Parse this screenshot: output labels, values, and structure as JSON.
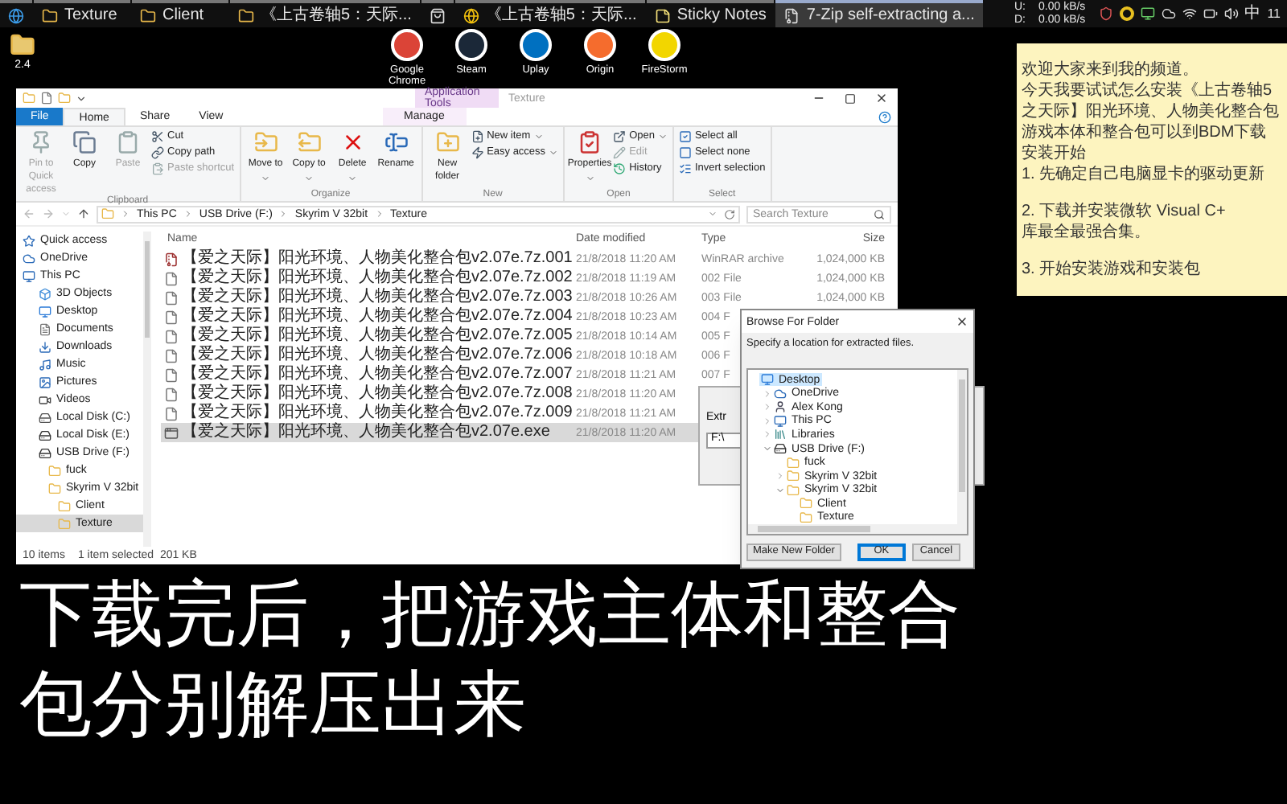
{
  "taskbar": {
    "buttons": [
      {
        "selected": false
      },
      {
        "label": "Texture",
        "selected": false
      },
      {
        "label": "Client",
        "selected": false
      },
      {
        "label": "《上古卷轴5：天际...",
        "selected": false
      },
      {
        "selected": false
      },
      {
        "label": "《上古卷轴5：天际...",
        "selected": false
      },
      {
        "label": "Sticky Notes",
        "selected": false
      },
      {
        "label": "7-Zip self-extracting a...",
        "selected": true
      }
    ],
    "net_speed": [
      {
        "label": "U:",
        "value": "0.00 kB/s"
      },
      {
        "label": "D:",
        "value": "0.00 kB/s"
      }
    ],
    "ime": "中",
    "clock": "11"
  },
  "desktop_icons": [
    {
      "label": "2.4"
    }
  ],
  "shortcuts": [
    {
      "label": "Google Chrome",
      "color": "#db4437"
    },
    {
      "label": "Steam",
      "color": "#1b2838"
    },
    {
      "label": "Uplay",
      "color": "#0070c0"
    },
    {
      "label": "Origin",
      "color": "#f56c2d"
    },
    {
      "label": "FireStorm",
      "color": "#f2d600"
    }
  ],
  "sticky_note": {
    "paragraphs": [
      [
        "欢迎大家来到我的频道。",
        "今天我要试试怎么安装《上古卷轴5",
        "之天际】阳光环境、人物美化整合包",
        "游戏本体和整合包可以到BDM下载",
        "安装开始",
        "1. 先确定自己电脑显卡的驱动更新"
      ],
      [
        "2. 下载并安装微软 Visual C+",
        "库最全最强合集。"
      ],
      [
        "3. 开始安装游戏和安装包"
      ]
    ]
  },
  "explorer": {
    "title": "Texture",
    "context_tab": "Application Tools",
    "tabs": [
      {
        "label": "File",
        "kind": "file",
        "selected": false
      },
      {
        "label": "Home",
        "kind": "tab",
        "selected": true
      },
      {
        "label": "Share",
        "kind": "tab",
        "selected": false
      },
      {
        "label": "View",
        "kind": "tab",
        "selected": false
      },
      {
        "label": "Manage",
        "kind": "context",
        "selected": false
      }
    ],
    "ribbon_groups": [
      {
        "name": "Clipboard",
        "items": [
          {
            "label": "Pin to Quick access",
            "kind": "large",
            "disabled": true,
            "dropdown": false
          },
          {
            "label": "Copy",
            "kind": "large",
            "disabled": false,
            "dropdown": false
          },
          {
            "label": "Paste",
            "kind": "large",
            "disabled": true,
            "dropdown": false
          },
          {
            "label": "Cut",
            "kind": "small",
            "disabled": false,
            "dropdown": false
          },
          {
            "label": "Copy path",
            "kind": "small",
            "disabled": false,
            "dropdown": false
          },
          {
            "label": "Paste shortcut",
            "kind": "small",
            "disabled": true,
            "dropdown": false
          }
        ]
      },
      {
        "name": "Organize",
        "items": [
          {
            "label": "Move to",
            "kind": "large",
            "disabled": false,
            "dropdown": true
          },
          {
            "label": "Copy to",
            "kind": "large",
            "disabled": false,
            "dropdown": true
          },
          {
            "label": "Delete",
            "kind": "large",
            "disabled": false,
            "dropdown": true
          },
          {
            "label": "Rename",
            "kind": "large",
            "disabled": false,
            "dropdown": false
          }
        ]
      },
      {
        "name": "New",
        "items": [
          {
            "label": "New folder",
            "kind": "large",
            "disabled": false,
            "dropdown": false
          },
          {
            "label": "New item",
            "kind": "small",
            "disabled": false,
            "dropdown": true
          },
          {
            "label": "Easy access",
            "kind": "small",
            "disabled": false,
            "dropdown": true
          }
        ]
      },
      {
        "name": "Open",
        "items": [
          {
            "label": "Properties",
            "kind": "large",
            "disabled": false,
            "dropdown": true
          },
          {
            "label": "Open",
            "kind": "small",
            "disabled": false,
            "dropdown": true
          },
          {
            "label": "Edit",
            "kind": "small",
            "disabled": true,
            "dropdown": false
          },
          {
            "label": "History",
            "kind": "small",
            "disabled": false,
            "dropdown": false
          }
        ]
      },
      {
        "name": "Select",
        "items": [
          {
            "label": "Select all",
            "kind": "small",
            "disabled": false,
            "dropdown": false
          },
          {
            "label": "Select none",
            "kind": "small",
            "disabled": false,
            "dropdown": false
          },
          {
            "label": "Invert selection",
            "kind": "small",
            "disabled": false,
            "dropdown": false
          }
        ]
      }
    ],
    "breadcrumb": [
      "This PC",
      "USB Drive (F:)",
      "Skyrim V 32bit",
      "Texture"
    ],
    "search": {
      "placeholder": "Search Texture"
    },
    "nav": [
      {
        "label": "Quick access",
        "kind": "star",
        "selected": false
      },
      {
        "label": "OneDrive",
        "kind": "cloud",
        "selected": false
      },
      {
        "label": "This PC",
        "kind": "pc",
        "selected": false,
        "children": [
          {
            "label": "3D Objects",
            "kind": "cube",
            "selected": false
          },
          {
            "label": "Desktop",
            "kind": "desktop",
            "selected": false
          },
          {
            "label": "Documents",
            "kind": "docs",
            "selected": false
          },
          {
            "label": "Downloads",
            "kind": "download",
            "selected": false
          },
          {
            "label": "Music",
            "kind": "music",
            "selected": false
          },
          {
            "label": "Pictures",
            "kind": "pictures",
            "selected": false
          },
          {
            "label": "Videos",
            "kind": "videos",
            "selected": false
          },
          {
            "label": "Local Disk (C:)",
            "kind": "disk",
            "selected": false
          },
          {
            "label": "Local Disk (E:)",
            "kind": "drive",
            "selected": false
          },
          {
            "label": "USB Drive (F:)",
            "kind": "drive",
            "selected": false,
            "children": [
              {
                "label": "fuck",
                "kind": "folder",
                "selected": false
              },
              {
                "label": "Skyrim V 32bit",
                "kind": "folder",
                "selected": false,
                "children": [
                  {
                    "label": "Client",
                    "kind": "folder",
                    "selected": false
                  },
                  {
                    "label": "Texture",
                    "kind": "folder",
                    "selected": true
                  }
                ]
              }
            ]
          }
        ]
      }
    ],
    "columns": [
      "Name",
      "Date modified",
      "Type",
      "Size"
    ],
    "rows": [
      {
        "name": "【爱之天际】阳光环境、人物美化整合包v2.07e.7z.001",
        "date": "21/8/2018 11:20 AM",
        "type": "WinRAR archive",
        "size": "1,024,000 KB",
        "kind": "archive",
        "selected": false
      },
      {
        "name": "【爱之天际】阳光环境、人物美化整合包v2.07e.7z.002",
        "date": "21/8/2018 11:19 AM",
        "type": "002 File",
        "size": "1,024,000 KB",
        "kind": "file",
        "selected": false
      },
      {
        "name": "【爱之天际】阳光环境、人物美化整合包v2.07e.7z.003",
        "date": "21/8/2018 10:26 AM",
        "type": "003 File",
        "size": "1,024,000 KB",
        "kind": "file",
        "selected": false
      },
      {
        "name": "【爱之天际】阳光环境、人物美化整合包v2.07e.7z.004",
        "date": "21/8/2018 10:23 AM",
        "type": "004 F",
        "kind": "file",
        "selected": false
      },
      {
        "name": "【爱之天际】阳光环境、人物美化整合包v2.07e.7z.005",
        "date": "21/8/2018 10:14 AM",
        "type": "005 F",
        "kind": "file",
        "selected": false
      },
      {
        "name": "【爱之天际】阳光环境、人物美化整合包v2.07e.7z.006",
        "date": "21/8/2018 10:18 AM",
        "type": "006 F",
        "kind": "file",
        "selected": false
      },
      {
        "name": "【爱之天际】阳光环境、人物美化整合包v2.07e.7z.007",
        "date": "21/8/2018 11:21 AM",
        "type": "007 F",
        "kind": "file",
        "selected": false
      },
      {
        "name": "【爱之天际】阳光环境、人物美化整合包v2.07e.7z.008",
        "date": "21/8/2018 11:20 AM",
        "kind": "file",
        "selected": false
      },
      {
        "name": "【爱之天际】阳光环境、人物美化整合包v2.07e.7z.009",
        "date": "21/8/2018 11:21 AM",
        "kind": "file",
        "selected": false
      },
      {
        "name": "【爱之天际】阳光环境、人物美化整合包v2.07e.exe",
        "date": "21/8/2018 11:20 AM",
        "kind": "exe",
        "selected": true
      }
    ],
    "status": [
      "10 items",
      "1 item selected  201 KB"
    ]
  },
  "sfx_dialog": {
    "label": "Extr",
    "path": "F:\\"
  },
  "browse_dialog": {
    "title": "Browse For Folder",
    "prompt": "Specify a location for extracted files.",
    "tree": [
      {
        "label": "Desktop",
        "kind": "desktop",
        "selected": true,
        "children": [
          {
            "label": "OneDrive",
            "kind": "cloud",
            "selected": false,
            "expanded": false
          },
          {
            "label": "Alex Kong",
            "kind": "user",
            "selected": false,
            "expanded": false
          },
          {
            "label": "This PC",
            "kind": "pc",
            "selected": false,
            "expanded": false
          },
          {
            "label": "Libraries",
            "kind": "library",
            "selected": false,
            "expanded": false
          },
          {
            "label": "USB Drive (F:)",
            "kind": "drive",
            "selected": false,
            "expanded": true,
            "children": [
              {
                "label": "fuck",
                "kind": "folder",
                "selected": false
              },
              {
                "label": "Skyrim V 32bit",
                "kind": "folder",
                "selected": false,
                "expanded": false
              },
              {
                "label": "Skyrim V 32bit",
                "kind": "folder",
                "selected": false,
                "expanded": true,
                "children": [
                  {
                    "label": "Client",
                    "kind": "folder",
                    "selected": false
                  },
                  {
                    "label": "Texture",
                    "kind": "folder",
                    "selected": false
                  }
                ]
              }
            ]
          }
        ]
      }
    ],
    "buttons": [
      {
        "label": "Make New Folder",
        "default": false
      },
      {
        "label": "OK",
        "default": true
      },
      {
        "label": "Cancel",
        "default": false
      }
    ]
  },
  "subtitle": {
    "lines": [
      "下载完后，把游戏主体和整合",
      "包分别解压出来"
    ]
  }
}
